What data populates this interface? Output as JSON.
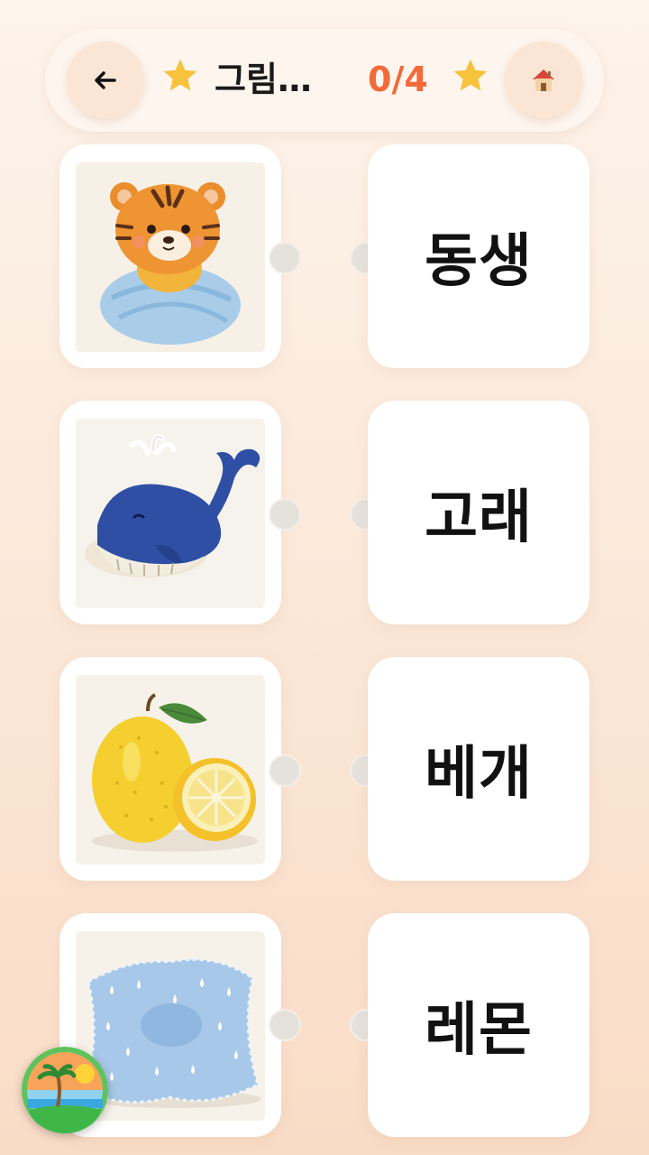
{
  "header": {
    "back_icon": "arrow-left-icon",
    "title": "그림…",
    "score": "0/4",
    "star_icon": "star-icon",
    "home_icon": "house-icon",
    "colors": {
      "score": "#f26b3a",
      "star": "#f7c23c"
    }
  },
  "pictures": [
    {
      "name": "baby-tiger-swaddled",
      "icon": "tiger-baby-image"
    },
    {
      "name": "whale",
      "icon": "whale-image"
    },
    {
      "name": "lemon",
      "icon": "lemon-image"
    },
    {
      "name": "pillow",
      "icon": "pillow-image"
    }
  ],
  "words": [
    "동생",
    "고래",
    "베개",
    "레몬"
  ],
  "badge": {
    "icon": "beach-island-logo"
  }
}
